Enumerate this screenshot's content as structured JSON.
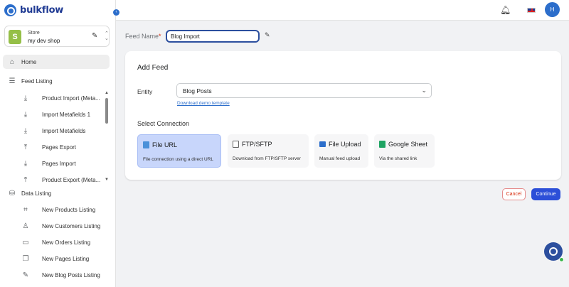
{
  "app": {
    "name": "bulkflow"
  },
  "store": {
    "label": "Store",
    "name": "my dev shop",
    "icon": "shopify-bag-icon"
  },
  "sidebar": {
    "home": {
      "label": "Home",
      "icon": "home-icon"
    },
    "feed_listing": {
      "label": "Feed Listing",
      "icon": "list-icon",
      "items": [
        {
          "label": "Product Import (Meta...",
          "icon": "download-icon"
        },
        {
          "label": "Import Metafields 1",
          "icon": "download-icon"
        },
        {
          "label": "Import Metafields",
          "icon": "download-icon"
        },
        {
          "label": "Pages Export",
          "icon": "upload-icon"
        },
        {
          "label": "Pages Import",
          "icon": "download-icon"
        },
        {
          "label": "Product Export (Meta...",
          "icon": "upload-icon"
        }
      ]
    },
    "data_listing": {
      "label": "Data Listing",
      "icon": "database-icon",
      "items": [
        {
          "label": "New Products Listing",
          "icon": "tag-icon"
        },
        {
          "label": "New Customers Listing",
          "icon": "add-user-icon"
        },
        {
          "label": "New Orders Listing",
          "icon": "inbox-icon"
        },
        {
          "label": "New Pages Listing",
          "icon": "pages-icon"
        },
        {
          "label": "New Blog Posts Listing",
          "icon": "edit-icon"
        }
      ]
    }
  },
  "header": {
    "avatar_initial": "H",
    "notifications_icon": "bell-icon",
    "language_icon": "uk-flag-icon"
  },
  "feed": {
    "label": "Feed Name",
    "required_mark": "*",
    "value": "Blog Import"
  },
  "card": {
    "title": "Add Feed",
    "entity_label": "Entity",
    "entity_value": "Blog Posts",
    "demo_link": "Download demo template",
    "connection_label": "Select Connection",
    "connections": [
      {
        "title": "File URL",
        "desc": "File connection using a direct URL",
        "icon": "file-url-icon",
        "selected": true
      },
      {
        "title": "FTP/SFTP",
        "desc": "Download from FTP/SFTP server",
        "icon": "ftp-icon",
        "selected": false
      },
      {
        "title": "File Upload",
        "desc": "Manual feed upload",
        "icon": "folder-icon",
        "selected": false
      },
      {
        "title": "Google Sheet",
        "desc": "Via the shared link",
        "icon": "google-sheet-icon",
        "selected": false
      }
    ]
  },
  "actions": {
    "cancel": "Cancel",
    "continue": "Continue"
  },
  "colors": {
    "primary": "#2c4fd8",
    "brand": "#2c6ecb",
    "selected_bg": "#c8d6fb",
    "danger": "#d72c0d"
  }
}
